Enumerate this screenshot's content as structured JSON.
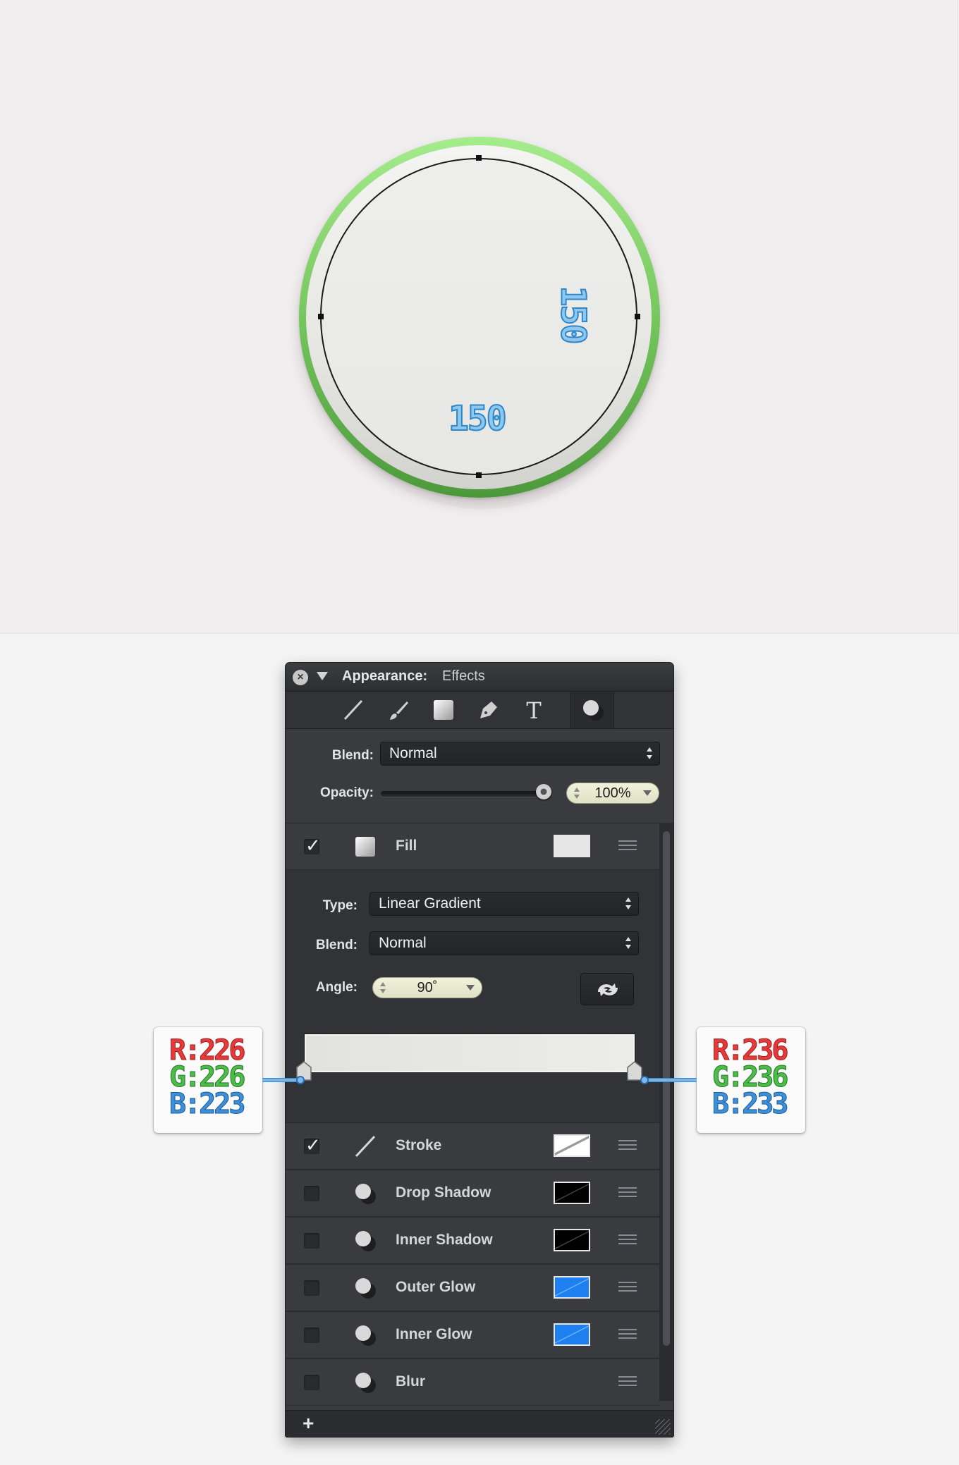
{
  "canvas": {
    "dimension_width": "150",
    "dimension_height": "150"
  },
  "panel": {
    "title": "Appearance:",
    "subtitle": "Effects",
    "tools": [
      "line-tool-icon",
      "brush-tool-icon",
      "rectangle-tool-icon",
      "pen-tool-icon",
      "text-tool-icon",
      "effects-tool-icon"
    ],
    "blend_label": "Blend:",
    "blend_value": "Normal",
    "opacity_label": "Opacity:",
    "opacity_value": "100%",
    "opacity_level": 1.0,
    "fill": {
      "checked": true,
      "label": "Fill",
      "type_label": "Type:",
      "type_value": "Linear Gradient",
      "blend_label": "Blend:",
      "blend_value": "Normal",
      "angle_label": "Angle:",
      "angle_value": "90˚",
      "gradient_start": "#e2e2df",
      "gradient_end": "#ececea"
    },
    "effects": [
      {
        "label": "Stroke",
        "checked": true,
        "swatch": "none"
      },
      {
        "label": "Drop Shadow",
        "checked": false,
        "swatch": "#000000"
      },
      {
        "label": "Inner Shadow",
        "checked": false,
        "swatch": "#000000"
      },
      {
        "label": "Outer Glow",
        "checked": false,
        "swatch": "#1e7ff0"
      },
      {
        "label": "Inner Glow",
        "checked": false,
        "swatch": "#1e7ff0"
      },
      {
        "label": "Blur",
        "checked": false,
        "swatch": ""
      }
    ],
    "add_label": "+"
  },
  "callouts": {
    "left": {
      "r": "R:226",
      "g": "G:226",
      "b": "B:223"
    },
    "right": {
      "r": "R:236",
      "g": "G:236",
      "b": "B:233"
    }
  },
  "colors": {
    "ring_green": "#72c25a",
    "panel_bg": "#3a3b3f",
    "dimension_blue": "#2f86c9"
  }
}
